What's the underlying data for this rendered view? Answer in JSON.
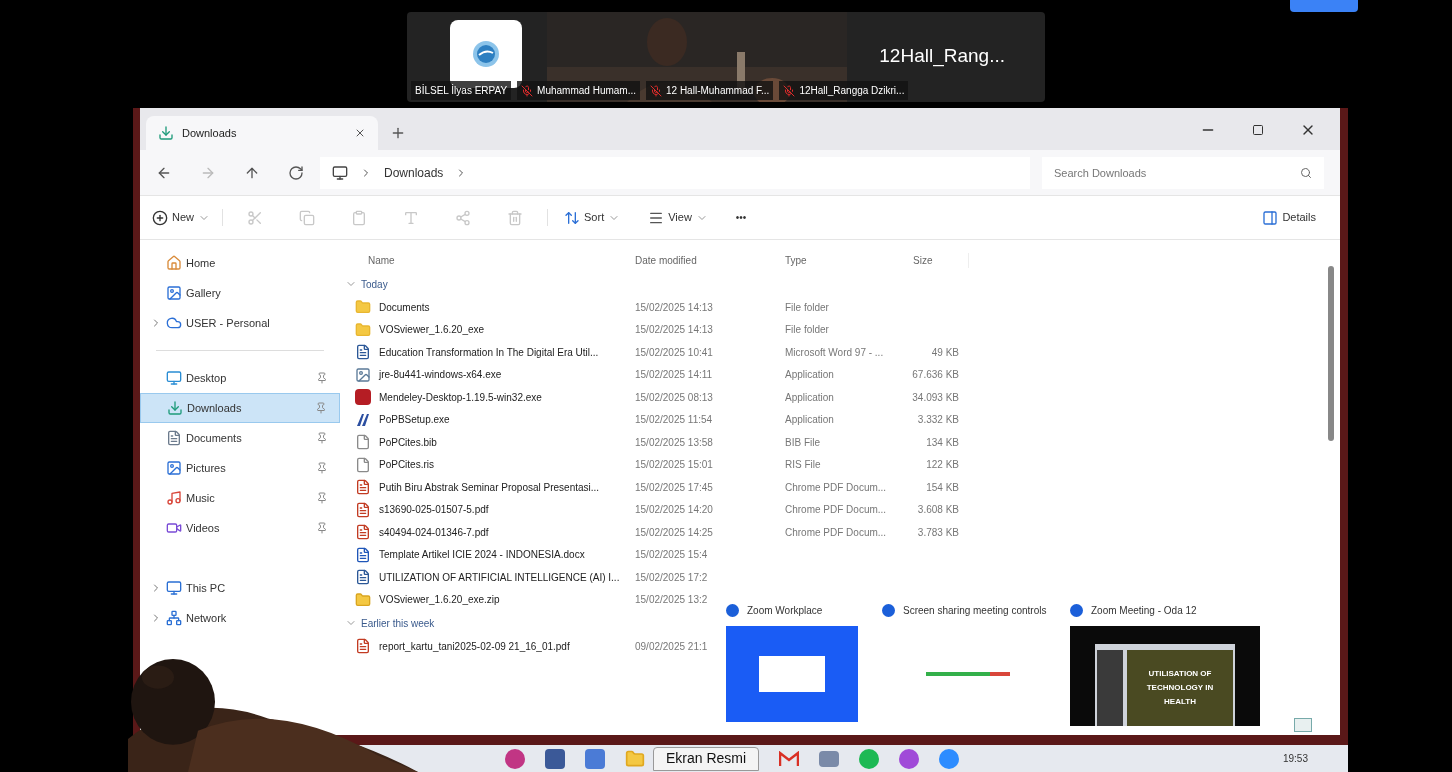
{
  "meeting": {
    "name_tile": "12Hall_Rang...",
    "participants": [
      {
        "name": "BİLSEL İlyas ERPAY",
        "muted": false
      },
      {
        "name": "Muhammad Humam...",
        "muted": true
      },
      {
        "name": "12 Hall-Muhammad F...",
        "muted": true
      },
      {
        "name": "12Hall_Rangga Dzikri...",
        "muted": true
      }
    ]
  },
  "explorer": {
    "tab": {
      "title": "Downloads",
      "selected": true
    },
    "breadcrumb": [
      "Downloads"
    ],
    "search": {
      "placeholder": "Search Downloads"
    },
    "commands": {
      "new": "New",
      "sort": "Sort",
      "view": "View",
      "more": "•••",
      "details": "Details"
    },
    "sidebar": [
      {
        "label": "Home",
        "kind": "home",
        "pinned": false,
        "expandable": false,
        "selected": false
      },
      {
        "label": "Gallery",
        "kind": "gallery",
        "pinned": false,
        "expandable": false,
        "selected": false
      },
      {
        "label": "USER - Personal",
        "kind": "cloud",
        "pinned": false,
        "expandable": true,
        "selected": false
      },
      {
        "label": "Desktop",
        "kind": "desktop",
        "pinned": true,
        "expandable": false,
        "selected": false
      },
      {
        "label": "Downloads",
        "kind": "downloads",
        "pinned": true,
        "expandable": false,
        "selected": true
      },
      {
        "label": "Documents",
        "kind": "documents",
        "pinned": true,
        "expandable": false,
        "selected": false
      },
      {
        "label": "Pictures",
        "kind": "pictures",
        "pinned": true,
        "expandable": false,
        "selected": false
      },
      {
        "label": "Music",
        "kind": "music",
        "pinned": true,
        "expandable": false,
        "selected": false
      },
      {
        "label": "Videos",
        "kind": "videos",
        "pinned": true,
        "expandable": false,
        "selected": false
      },
      {
        "label": "This PC",
        "kind": "pc",
        "pinned": false,
        "expandable": true,
        "selected": false
      },
      {
        "label": "Network",
        "kind": "network",
        "pinned": false,
        "expandable": true,
        "selected": false
      }
    ],
    "columns": [
      "Name",
      "Date modified",
      "Type",
      "Size"
    ],
    "groups": [
      {
        "label": "Today",
        "expanded": true,
        "rows": [
          {
            "name": "Documents",
            "kind": "folder",
            "date": "15/02/2025 14:13",
            "type": "File folder"
          },
          {
            "name": "VOSviewer_1.6.20_exe",
            "kind": "folder",
            "date": "15/02/2025 14:13",
            "type": "File folder"
          },
          {
            "name": "Education Transformation In The Digital Era Util...",
            "kind": "word",
            "date": "15/02/2025 10:41",
            "type": "Microsoft Word 97 - ...",
            "size": "49 KB"
          },
          {
            "name": "jre-8u441-windows-x64.exe",
            "kind": "app",
            "date": "15/02/2025 14:11",
            "type": "Application",
            "size": "67.636 KB"
          },
          {
            "name": "Mendeley-Desktop-1.19.5-win32.exe",
            "kind": "mendeley",
            "date": "15/02/2025 08:13",
            "type": "Application",
            "size": "34.093 KB"
          },
          {
            "name": "PoPBSetup.exe",
            "kind": "popb",
            "date": "15/02/2025 11:54",
            "type": "Application",
            "size": "3.332 KB"
          },
          {
            "name": "PoPCites.bib",
            "kind": "file",
            "date": "15/02/2025 13:58",
            "type": "BIB File",
            "size": "134 KB"
          },
          {
            "name": "PoPCites.ris",
            "kind": "file",
            "date": "15/02/2025 15:01",
            "type": "RIS File",
            "size": "122 KB"
          },
          {
            "name": "Putih Biru Abstrak Seminar Proposal Presentasi...",
            "kind": "pdf",
            "date": "15/02/2025 17:45",
            "type": "Chrome PDF Docum...",
            "size": "154 KB"
          },
          {
            "name": "s13690-025-01507-5.pdf",
            "kind": "pdf",
            "date": "15/02/2025 14:20",
            "type": "Chrome PDF Docum...",
            "size": "3.608 KB"
          },
          {
            "name": "s40494-024-01346-7.pdf",
            "kind": "pdf",
            "date": "15/02/2025 14:25",
            "type": "Chrome PDF Docum...",
            "size": "3.783 KB"
          },
          {
            "name": "Template Artikel ICIE 2024 - INDONESIA.docx",
            "kind": "docx",
            "date": "15/02/2025 15:4"
          },
          {
            "name": "UTILIZATION OF ARTIFICIAL INTELLIGENCE (AI) I...",
            "kind": "word",
            "date": "15/02/2025 17:2"
          },
          {
            "name": "VOSviewer_1.6.20_exe.zip",
            "kind": "zip",
            "date": "15/02/2025 13:2"
          }
        ]
      },
      {
        "label": "Earlier this week",
        "expanded": true,
        "rows": [
          {
            "name": "report_kartu_tani2025-02-09 21_16_01.pdf",
            "kind": "pdf",
            "date": "09/02/2025 21:1"
          }
        ]
      }
    ]
  },
  "switcher": [
    {
      "title": "Zoom Workplace",
      "kind": "workplace"
    },
    {
      "title": "Screen sharing meeting controls",
      "kind": "controls"
    },
    {
      "title": "Zoom Meeting - Oda 12",
      "kind": "meeting",
      "slide": [
        "UTILISATION OF",
        "TECHNOLOGY IN",
        "HEALTH"
      ]
    }
  ],
  "taskbar": {
    "active_app": "Ekran Resmi",
    "clock": "19:53"
  }
}
